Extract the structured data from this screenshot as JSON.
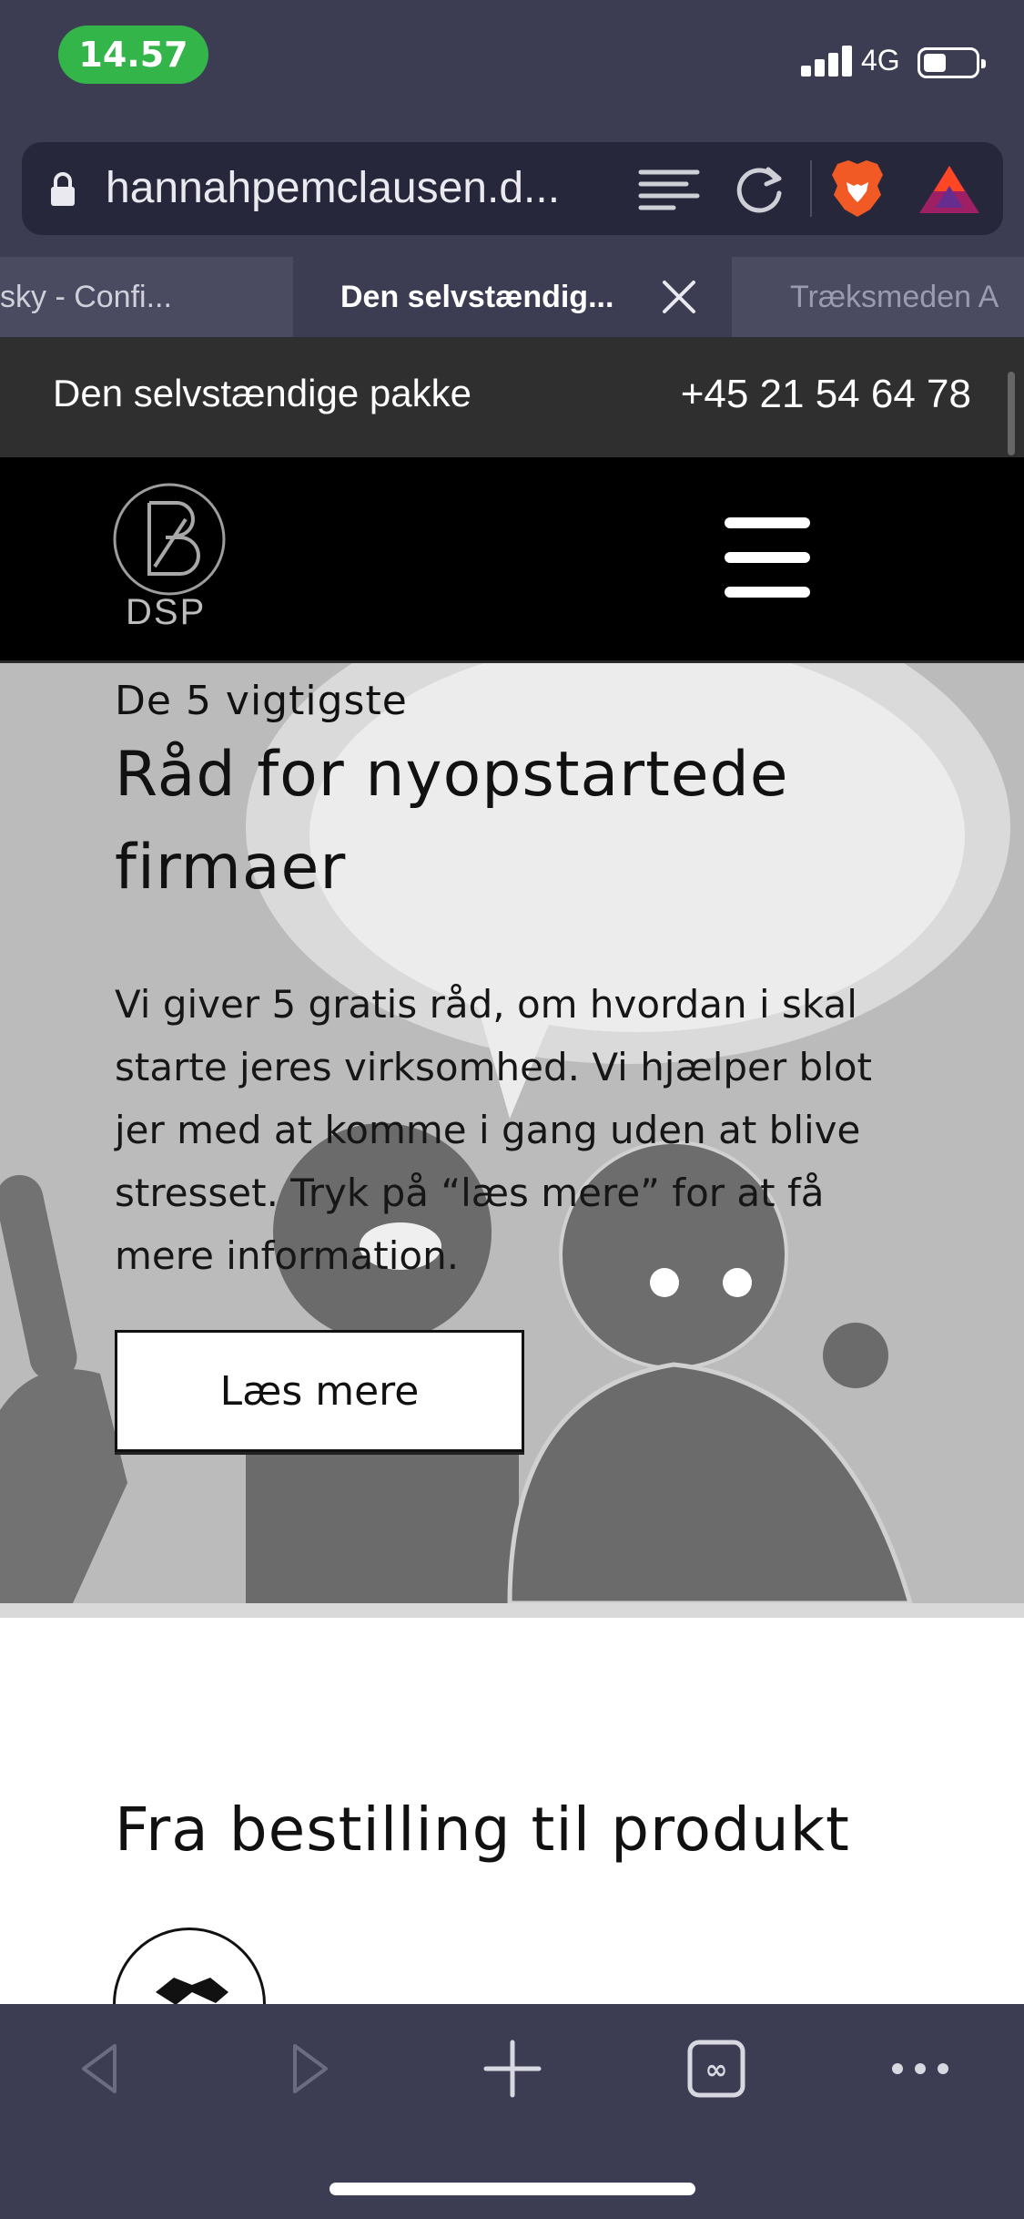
{
  "status_bar": {
    "time": "14.57",
    "network": "4G",
    "battery_level": 0.35
  },
  "browser": {
    "url": "hannahpemclausen.d...",
    "icons": [
      "lock-icon",
      "reader-mode-icon",
      "reload-icon",
      "brave-shields-icon",
      "brave-rewards-icon"
    ],
    "tabs": [
      {
        "label": "sky - Confi...",
        "active": false
      },
      {
        "label": "Den selvstændig...",
        "active": true
      },
      {
        "label": "Træksmeden A",
        "active": false
      }
    ],
    "toolbar_icons": [
      "back-icon",
      "forward-icon",
      "new-tab-icon",
      "tabs-icon",
      "more-icon"
    ]
  },
  "page": {
    "topbar": {
      "title": "Den selvstændige pakke",
      "phone": "+45 21 54 64 78"
    },
    "header": {
      "logo_text": "DSP",
      "menu_icon": "hamburger-menu-icon"
    },
    "hero": {
      "kicker": "De 5 vigtigste",
      "title": "Råd for nyopstartede firmaer",
      "body": "Vi giver 5 gratis råd, om hvordan i skal starte jeres virksomhed. Vi hjælper blot jer med at komme i gang uden at blive stresset. Tryk på “læs mere” for at få mere information.",
      "button": "Læs mere"
    },
    "section": {
      "title": "Fra bestilling til produkt",
      "icon": "handshake-icon"
    }
  },
  "colors": {
    "browser_chrome": "#3c3d52",
    "url_field": "#26273a",
    "time_pill": "#33b54a",
    "topbar": "#2f2f2f",
    "header": "#000000",
    "hero_bg": "#b9b9b9"
  }
}
